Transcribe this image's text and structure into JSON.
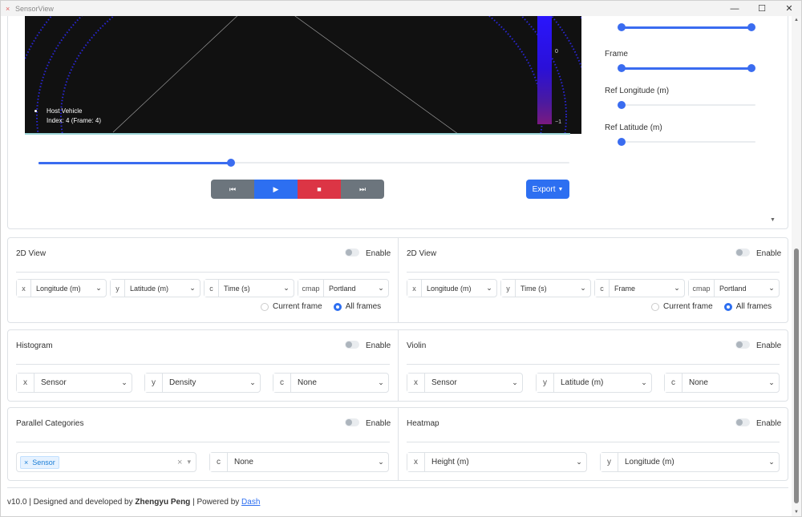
{
  "window": {
    "title": "SensorView",
    "controls": {
      "minimize": "—",
      "maximize": "☐",
      "close": "✕"
    }
  },
  "plot": {
    "legend_item": "Host Vehicle",
    "legend_sub": "Index: 4 (Frame: 4)",
    "colorbar_ticks": [
      "0",
      "−1"
    ]
  },
  "timeline": {
    "progress": 0.36
  },
  "playback": {
    "first_label": "⏮",
    "play_label": "▶",
    "stop_label": "■",
    "last_label": "⏭"
  },
  "export": {
    "label": "Export",
    "caret": "▼"
  },
  "sidebar": {
    "sliders": [
      {
        "label": "Frame",
        "range": [
          0.0,
          1.0
        ]
      },
      {
        "label": "Ref Longitude (m)",
        "value": 0.0
      },
      {
        "label": "Ref Latitude (m)",
        "value": 0.0
      }
    ]
  },
  "panels": {
    "view2d_left": {
      "title": "2D View",
      "enable_label": "Enable",
      "x": {
        "prefix": "x",
        "value": "Longitude (m)"
      },
      "y": {
        "prefix": "y",
        "value": "Latitude (m)"
      },
      "c": {
        "prefix": "c",
        "value": "Time (s)"
      },
      "cmap": {
        "prefix": "cmap",
        "value": "Portland"
      },
      "radio": {
        "current": "Current frame",
        "all": "All frames",
        "selected": "all"
      }
    },
    "view2d_right": {
      "title": "2D View",
      "enable_label": "Enable",
      "x": {
        "prefix": "x",
        "value": "Longitude (m)"
      },
      "y": {
        "prefix": "y",
        "value": "Time (s)"
      },
      "c": {
        "prefix": "c",
        "value": "Frame"
      },
      "cmap": {
        "prefix": "cmap",
        "value": "Portland"
      },
      "radio": {
        "current": "Current frame",
        "all": "All frames",
        "selected": "all"
      }
    },
    "histogram": {
      "title": "Histogram",
      "enable_label": "Enable",
      "x": {
        "prefix": "x",
        "value": "Sensor"
      },
      "y": {
        "prefix": "y",
        "value": "Density"
      },
      "c": {
        "prefix": "c",
        "value": "None"
      }
    },
    "violin": {
      "title": "Violin",
      "enable_label": "Enable",
      "x": {
        "prefix": "x",
        "value": "Sensor"
      },
      "y": {
        "prefix": "y",
        "value": "Latitude (m)"
      },
      "c": {
        "prefix": "c",
        "value": "None"
      }
    },
    "parallel": {
      "title": "Parallel Categories",
      "enable_label": "Enable",
      "tag": "Sensor",
      "tag_remove": "×",
      "clear": "×",
      "caret": "▾",
      "c": {
        "prefix": "c",
        "value": "None"
      }
    },
    "heatmap": {
      "title": "Heatmap",
      "enable_label": "Enable",
      "x": {
        "prefix": "x",
        "value": "Height (m)"
      },
      "y": {
        "prefix": "y",
        "value": "Longitude (m)"
      }
    }
  },
  "footer": {
    "version": "v10.0",
    "designed": " | Designed and developed by ",
    "author": "Zhengyu Peng",
    "powered": " | Powered by ",
    "link": "Dash"
  },
  "colors": {
    "accent": "#2d6ff1",
    "danger": "#dc3545",
    "secondary": "#6c757d",
    "plot_bg": "#111111"
  }
}
